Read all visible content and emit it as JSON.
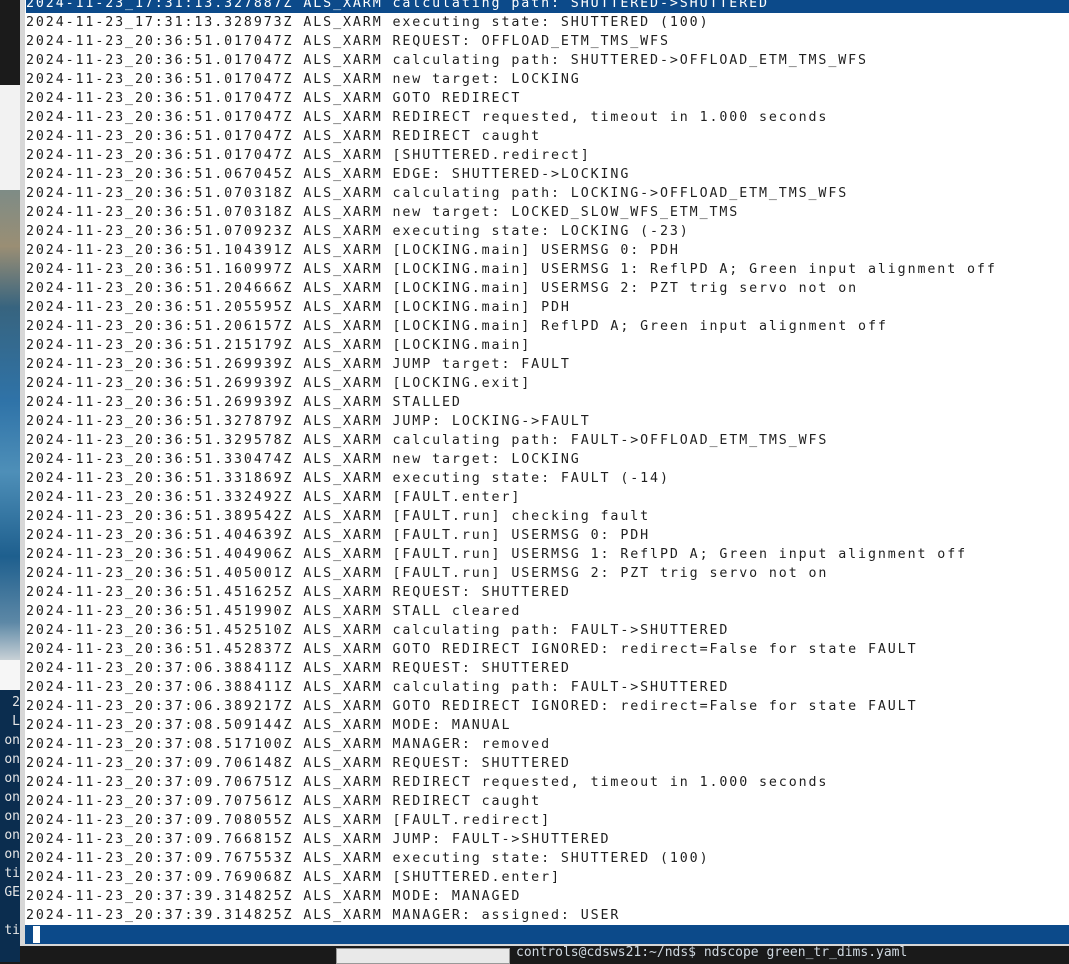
{
  "log": {
    "lines": [
      "2024-11-23_17:31:13.327887Z ALS_XARM calculating path: SHUTTERED->SHUTTERED",
      "2024-11-23_17:31:13.328973Z ALS_XARM executing state: SHUTTERED (100)",
      "2024-11-23_20:36:51.017047Z ALS_XARM REQUEST: OFFLOAD_ETM_TMS_WFS",
      "2024-11-23_20:36:51.017047Z ALS_XARM calculating path: SHUTTERED->OFFLOAD_ETM_TMS_WFS",
      "2024-11-23_20:36:51.017047Z ALS_XARM new target: LOCKING",
      "2024-11-23_20:36:51.017047Z ALS_XARM GOTO REDIRECT",
      "2024-11-23_20:36:51.017047Z ALS_XARM REDIRECT requested, timeout in 1.000 seconds",
      "2024-11-23_20:36:51.017047Z ALS_XARM REDIRECT caught",
      "2024-11-23_20:36:51.017047Z ALS_XARM [SHUTTERED.redirect]",
      "2024-11-23_20:36:51.067045Z ALS_XARM EDGE: SHUTTERED->LOCKING",
      "2024-11-23_20:36:51.070318Z ALS_XARM calculating path: LOCKING->OFFLOAD_ETM_TMS_WFS",
      "2024-11-23_20:36:51.070318Z ALS_XARM new target: LOCKED_SLOW_WFS_ETM_TMS",
      "2024-11-23_20:36:51.070923Z ALS_XARM executing state: LOCKING (-23)",
      "2024-11-23_20:36:51.104391Z ALS_XARM [LOCKING.main] USERMSG 0: PDH",
      "2024-11-23_20:36:51.160997Z ALS_XARM [LOCKING.main] USERMSG 1: ReflPD A; Green input alignment off",
      "2024-11-23_20:36:51.204666Z ALS_XARM [LOCKING.main] USERMSG 2: PZT trig servo not on",
      "2024-11-23_20:36:51.205595Z ALS_XARM [LOCKING.main] PDH",
      "2024-11-23_20:36:51.206157Z ALS_XARM [LOCKING.main] ReflPD A; Green input alignment off",
      "2024-11-23_20:36:51.215179Z ALS_XARM [LOCKING.main]",
      "2024-11-23_20:36:51.269939Z ALS_XARM JUMP target: FAULT",
      "2024-11-23_20:36:51.269939Z ALS_XARM [LOCKING.exit]",
      "2024-11-23_20:36:51.269939Z ALS_XARM STALLED",
      "2024-11-23_20:36:51.327879Z ALS_XARM JUMP: LOCKING->FAULT",
      "2024-11-23_20:36:51.329578Z ALS_XARM calculating path: FAULT->OFFLOAD_ETM_TMS_WFS",
      "2024-11-23_20:36:51.330474Z ALS_XARM new target: LOCKING",
      "2024-11-23_20:36:51.331869Z ALS_XARM executing state: FAULT (-14)",
      "2024-11-23_20:36:51.332492Z ALS_XARM [FAULT.enter]",
      "2024-11-23_20:36:51.389542Z ALS_XARM [FAULT.run] checking fault",
      "2024-11-23_20:36:51.404639Z ALS_XARM [FAULT.run] USERMSG 0: PDH",
      "2024-11-23_20:36:51.404906Z ALS_XARM [FAULT.run] USERMSG 1: ReflPD A; Green input alignment off",
      "2024-11-23_20:36:51.405001Z ALS_XARM [FAULT.run] USERMSG 2: PZT trig servo not on",
      "2024-11-23_20:36:51.451625Z ALS_XARM REQUEST: SHUTTERED",
      "2024-11-23_20:36:51.451990Z ALS_XARM STALL cleared",
      "2024-11-23_20:36:51.452510Z ALS_XARM calculating path: FAULT->SHUTTERED",
      "2024-11-23_20:36:51.452837Z ALS_XARM GOTO REDIRECT IGNORED: redirect=False for state FAULT",
      "2024-11-23_20:37:06.388411Z ALS_XARM REQUEST: SHUTTERED",
      "2024-11-23_20:37:06.388411Z ALS_XARM calculating path: FAULT->SHUTTERED",
      "2024-11-23_20:37:06.389217Z ALS_XARM GOTO REDIRECT IGNORED: redirect=False for state FAULT",
      "2024-11-23_20:37:08.509144Z ALS_XARM MODE: MANUAL",
      "2024-11-23_20:37:08.517100Z ALS_XARM MANAGER: removed",
      "2024-11-23_20:37:09.706148Z ALS_XARM REQUEST: SHUTTERED",
      "2024-11-23_20:37:09.706751Z ALS_XARM REDIRECT requested, timeout in 1.000 seconds",
      "2024-11-23_20:37:09.707561Z ALS_XARM REDIRECT caught",
      "2024-11-23_20:37:09.708055Z ALS_XARM [FAULT.redirect]",
      "2024-11-23_20:37:09.766815Z ALS_XARM JUMP: FAULT->SHUTTERED",
      "2024-11-23_20:37:09.767553Z ALS_XARM executing state: SHUTTERED (100)",
      "2024-11-23_20:37:09.769068Z ALS_XARM [SHUTTERED.enter]",
      "2024-11-23_20:37:39.314825Z ALS_XARM MODE: MANAGED",
      "2024-11-23_20:37:39.314825Z ALS_XARM MANAGER: assigned: USER"
    ],
    "selected_index": 0
  },
  "background": {
    "left_terminal_fragments": [
      "2",
      "L",
      "on",
      "on",
      "on",
      "on",
      "on",
      "on",
      "on",
      "ti",
      "GE",
      "",
      "ti"
    ],
    "bottom_terminal_text": "controls@cdsws21:~/nds$ ndscope green_tr_dims.yaml"
  },
  "colors": {
    "selection": "#0c4a8a",
    "log_text": "#1f1f1f",
    "log_background": "#ffffff"
  }
}
